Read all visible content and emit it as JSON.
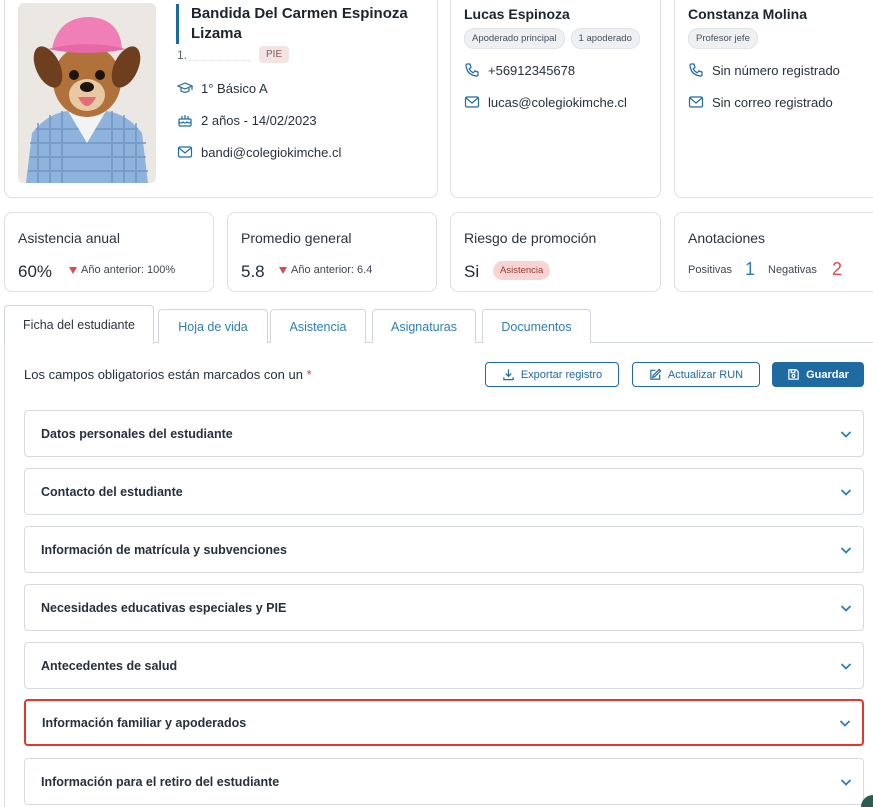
{
  "student": {
    "name_line1": "Bandida Del Carmen Espinoza",
    "name_line2": "Lizama",
    "rut_prefix": "1.",
    "pie_badge": "PIE",
    "course": "1° Básico A",
    "age_birth": "2 años - 14/02/2023",
    "email": "bandi@colegiokimche.cl"
  },
  "guardian": {
    "name": "Lucas Espinoza",
    "badges": [
      "Apoderado principal",
      "1 apoderado"
    ],
    "phone": "+56912345678",
    "email": "lucas@colegiokimche.cl"
  },
  "teacher": {
    "name": "Constanza Molina",
    "badge": "Profesor jefe",
    "phone": "Sin número registrado",
    "email": "Sin correo registrado"
  },
  "kpis": {
    "attendance": {
      "title": "Asistencia anual",
      "value": "60%",
      "previous": "Año anterior: 100%"
    },
    "average": {
      "title": "Promedio general",
      "value": "5.8",
      "previous": "Año anterior: 6.4"
    },
    "risk": {
      "title": "Riesgo de promoción",
      "value": "Si",
      "badge": "Asistencia"
    },
    "notes": {
      "title": "Anotaciones",
      "positive_label": "Positivas",
      "positive_count": "1",
      "negative_label": "Negativas",
      "negative_count": "2"
    }
  },
  "tabs": [
    "Ficha del estudiante",
    "Hoja de vida",
    "Asistencia",
    "Asignaturas",
    "Documentos"
  ],
  "form": {
    "required_note": "Los campos obligatorios están marcados con un",
    "required_star": "*",
    "export_label": "Exportar registro",
    "update_label": "Actualizar RUN",
    "save_label": "Guardar"
  },
  "sections": [
    "Datos personales del estudiante",
    "Contacto del estudiante",
    "Información de matrícula y subvenciones",
    "Necesidades educativas especiales y PIE",
    "Antecedentes de salud",
    "Información familiar y apoderados",
    "Información para el retiro del estudiante"
  ],
  "colors": {
    "accent": "#1f6aa0",
    "link": "#2d7fb3",
    "highlight": "#e0392b",
    "negative": "#d84b55",
    "positive": "#2d7fb3"
  }
}
